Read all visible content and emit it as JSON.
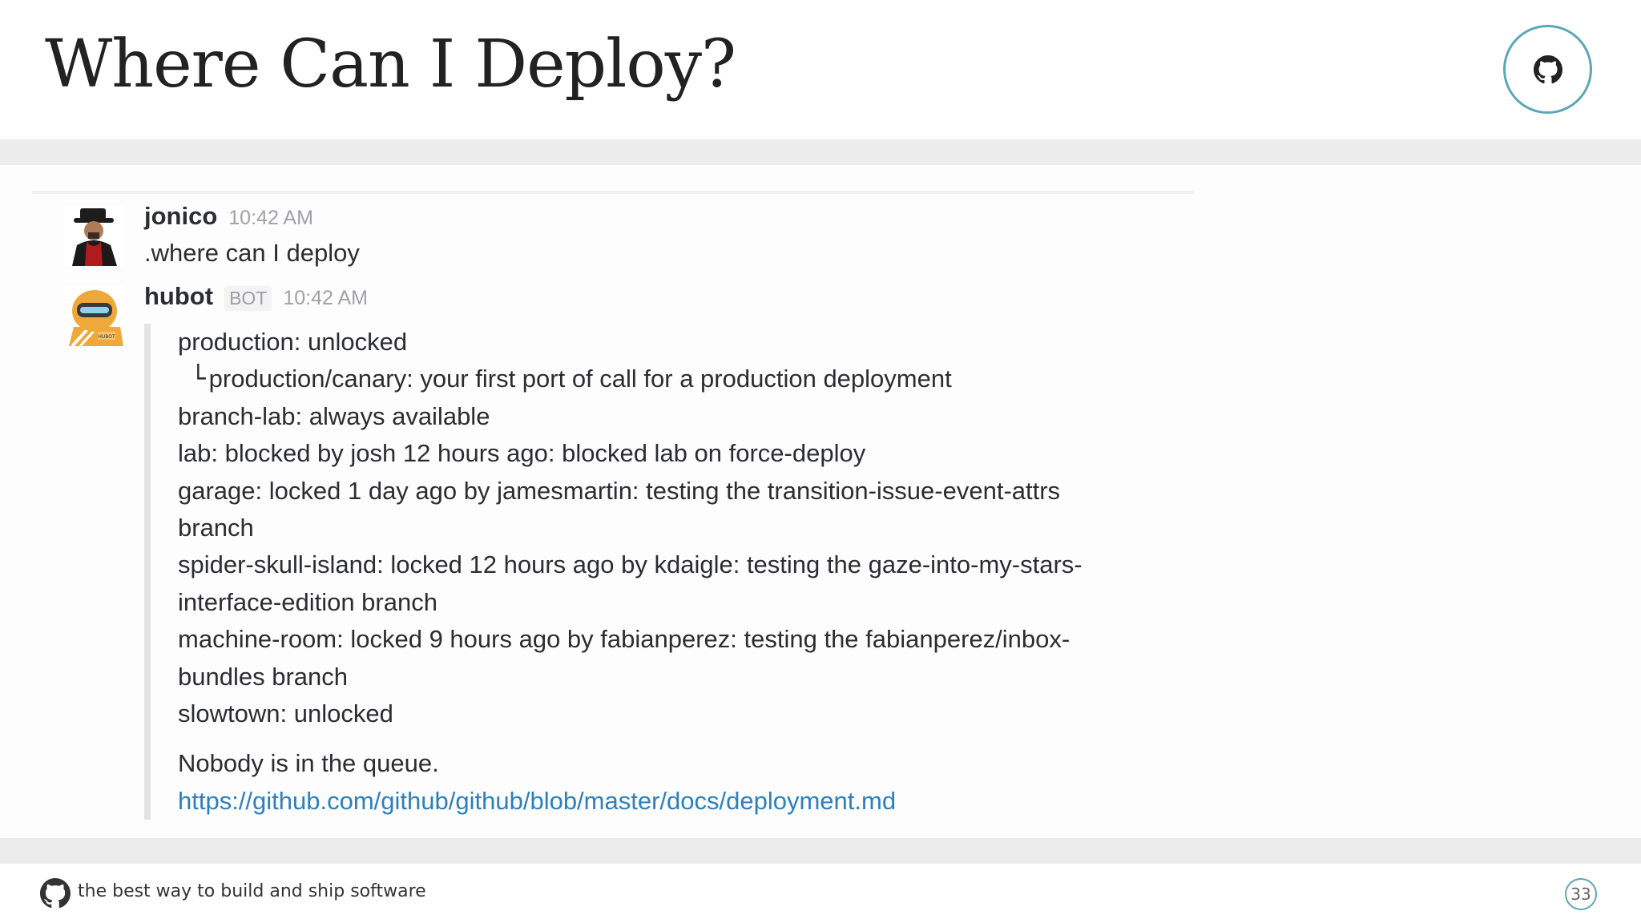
{
  "slide": {
    "title": "Where Can I Deploy?",
    "footer_text": "the best way to build and ship software",
    "page_number": "33",
    "accent_color": "#5aa7b5"
  },
  "chat": {
    "messages": [
      {
        "author": "jonico",
        "timestamp": "10:42 AM",
        "text": ".where can I deploy"
      },
      {
        "author": "hubot",
        "badge": "BOT",
        "timestamp": "10:42 AM",
        "attachment": {
          "lines": [
            "production: unlocked",
            "production/canary: your first port of call for a production deployment",
            "branch-lab: always available",
            "lab: blocked by josh 12 hours ago: blocked lab on force-deploy",
            "garage: locked 1 day ago by jamesmartin: testing the transition-issue-event-attrs",
            "branch",
            "spider-skull-island: locked 12 hours ago by kdaigle: testing the gaze-into-my-stars-",
            "interface-edition branch",
            "machine-room: locked 9 hours ago by fabianperez: testing the fabianperez/inbox-",
            "bundles branch",
            "slowtown: unlocked"
          ],
          "tree_mark": "└",
          "queue_text": "Nobody is in the queue.",
          "link": "https://github.com/github/github/blob/master/docs/deployment.md",
          "link_color": "#2d7fbd"
        }
      }
    ]
  },
  "icons": {
    "header_logo": "github-octocat-icon",
    "footer_logo": "github-octocat-icon"
  }
}
